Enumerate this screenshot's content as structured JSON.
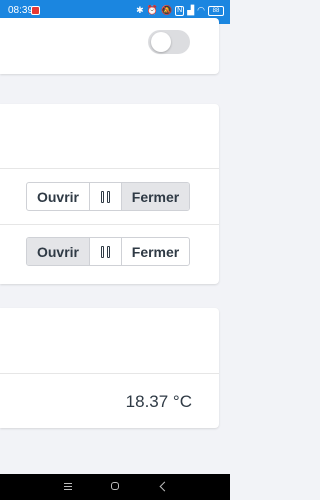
{
  "status_bar": {
    "time": "08:39",
    "icons": [
      "bluetooth-icon",
      "alarm-icon",
      "mute-icon",
      "nfc-icon",
      "signal-icon",
      "wifi-icon",
      "battery-icon"
    ],
    "nfc_label": "N",
    "battery_level": "88"
  },
  "controls": {
    "toggle": {
      "state": "off"
    },
    "shutter_1": {
      "open_label": "Ouvrir",
      "close_label": "Fermer",
      "active": "close"
    },
    "shutter_2": {
      "open_label": "Ouvrir",
      "close_label": "Fermer",
      "active": "open"
    }
  },
  "sensor": {
    "temperature": "18.37 °C"
  },
  "colors": {
    "status_bar": "#1b86e0",
    "background": "#f2f3f7",
    "button_active": "#e4e5e8"
  }
}
